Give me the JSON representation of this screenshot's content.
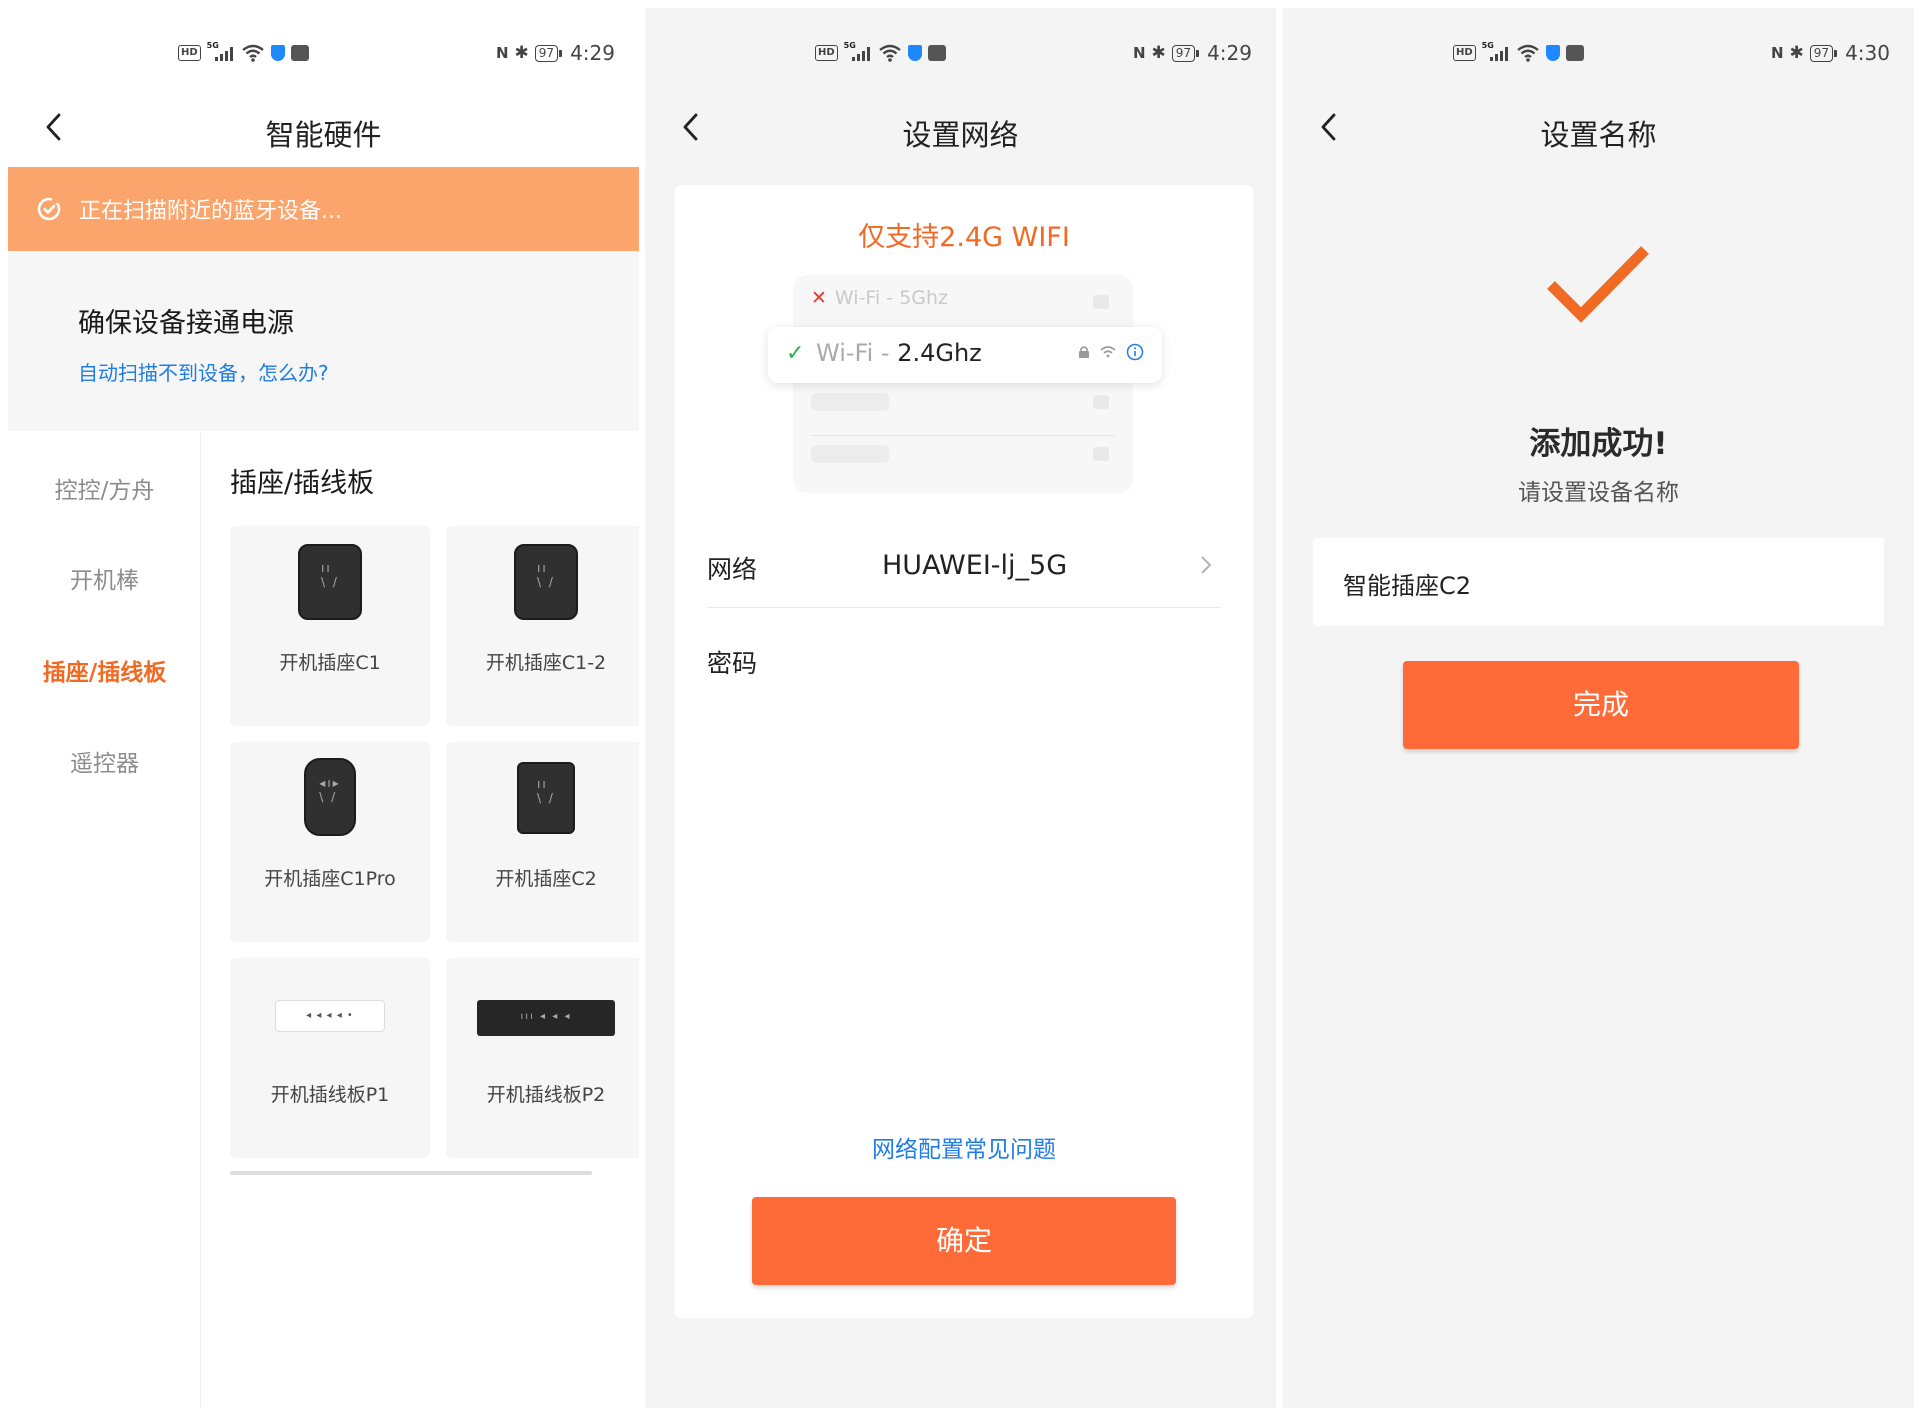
{
  "status": {
    "battery": "97",
    "time_1": "4:29",
    "time_2": "4:29",
    "time_3": "4:30",
    "hd": "HD",
    "net": "5G"
  },
  "screen1": {
    "title": "智能硬件",
    "scan_text": "正在扫描附近的蓝牙设备...",
    "tip_title": "确保设备接通电源",
    "tip_link": "自动扫描不到设备，怎么办?",
    "sidebar": [
      "控控/方舟",
      "开机棒",
      "插座/插线板",
      "遥控器"
    ],
    "active_index": 2,
    "category_title": "插座/插线板",
    "products": [
      "开机插座C1",
      "开机插座C1-2",
      "开机插座C1Pro",
      "开机插座C2",
      "开机插线板P1",
      "开机插线板P2"
    ]
  },
  "screen2": {
    "title": "设置网络",
    "wifi_only": "仅支持2.4G WIFI",
    "illu_5g_prefix": "Wi-Fi - ",
    "illu_5g": "5Ghz",
    "illu_24_prefix": "Wi-Fi - ",
    "illu_24": "2.4Ghz",
    "network_label": "网络",
    "network_value": "HUAWEI-lj_5G",
    "password_label": "密码",
    "password_value": "",
    "faq": "网络配置常见问题",
    "confirm": "确定"
  },
  "screen3": {
    "title": "设置名称",
    "success": "添加成功!",
    "subtitle": "请设置设备名称",
    "device_name": "智能插座C2",
    "done": "完成"
  },
  "colors": {
    "accent": "#fe6a38",
    "scan_bar": "#fba56c",
    "link": "#1e7de8",
    "active": "#f06a24"
  }
}
